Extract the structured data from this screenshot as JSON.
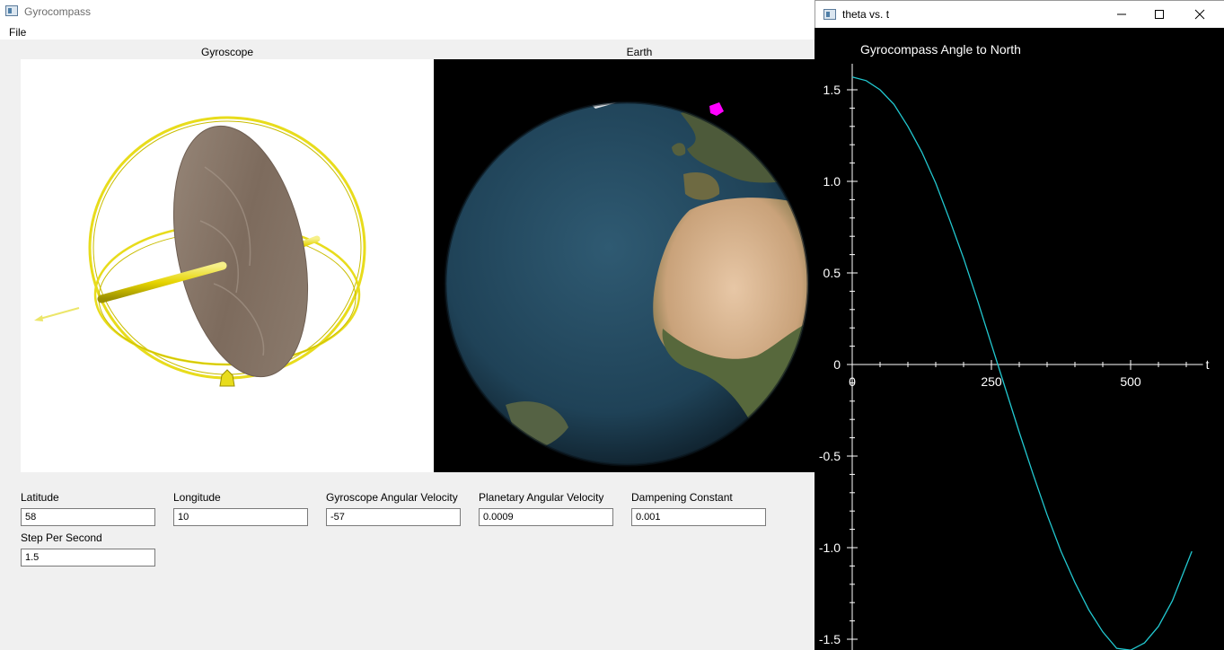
{
  "main_window": {
    "title": "Gyrocompass",
    "menu": [
      "File"
    ],
    "panels": {
      "gyroscope_label": "Gyroscope",
      "earth_label": "Earth"
    },
    "params": [
      {
        "label": "Latitude",
        "value": "58"
      },
      {
        "label": "Longitude",
        "value": "10"
      },
      {
        "label": "Gyroscope Angular Velocity",
        "value": "-57"
      },
      {
        "label": "Planetary Angular Velocity",
        "value": "0.0009"
      },
      {
        "label": "Dampening Constant",
        "value": "0.001"
      },
      {
        "label": "Step Per Second",
        "value": "1.5"
      }
    ]
  },
  "plot_window": {
    "title": "theta vs. t",
    "controls": [
      "minimize-icon",
      "maximize-icon",
      "close-icon"
    ]
  },
  "chart_data": {
    "type": "line",
    "title": "Gyrocompass Angle to North",
    "xlabel": "t",
    "ylabel": "",
    "xlim": [
      0,
      630
    ],
    "ylim": [
      -1.5,
      1.6
    ],
    "x_ticks": [
      "0",
      "250",
      "500"
    ],
    "y_ticks": [
      "1.5",
      "1.0",
      "0.5",
      "0",
      "-0.5",
      "-1.0",
      "-1.5"
    ],
    "series": [
      {
        "color": "#22c8d0",
        "x": [
          0,
          25,
          50,
          75,
          100,
          125,
          150,
          175,
          200,
          225,
          250,
          275,
          300,
          325,
          350,
          375,
          400,
          425,
          450,
          475,
          500,
          525,
          550,
          575,
          610
        ],
        "y": [
          1.57,
          1.55,
          1.5,
          1.42,
          1.3,
          1.16,
          0.99,
          0.79,
          0.58,
          0.35,
          0.11,
          -0.13,
          -0.37,
          -0.6,
          -0.82,
          -1.02,
          -1.19,
          -1.34,
          -1.46,
          -1.55,
          -1.56,
          -1.52,
          -1.43,
          -1.29,
          -1.02
        ]
      }
    ],
    "colors": {
      "background": "#000000",
      "axes": "#ffffff",
      "line": "#22c8d0"
    }
  }
}
